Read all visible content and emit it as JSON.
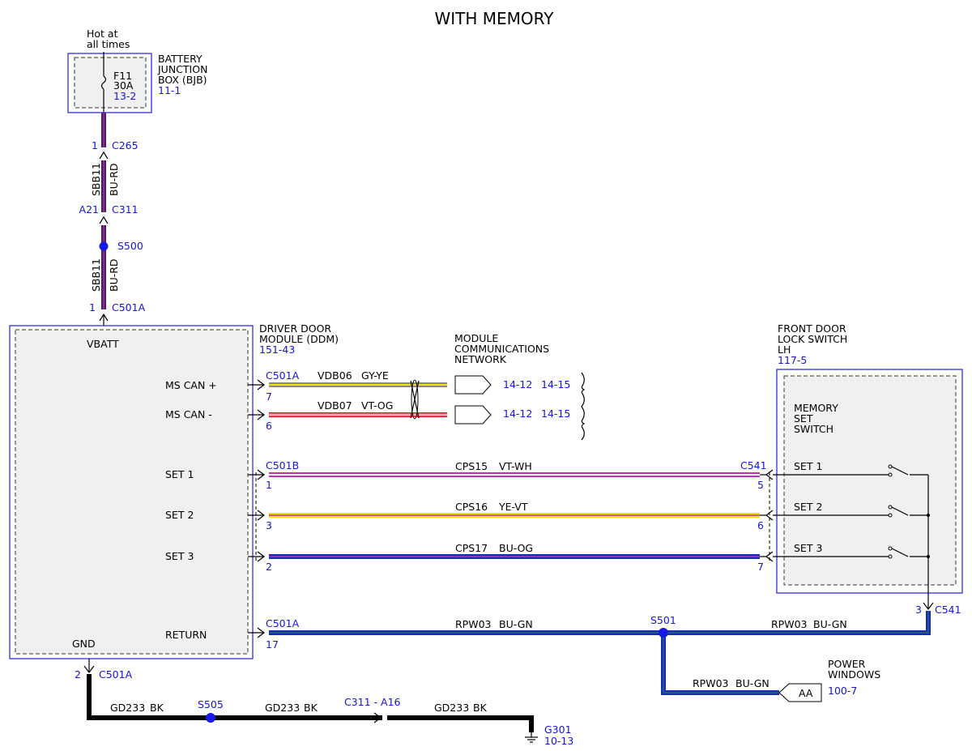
{
  "title": "WITH MEMORY",
  "colors": {
    "blue_label": "#1515d8",
    "box_outline": "#3030e0",
    "box_fill": "#f0f0f0",
    "BU": "#1a2ab8",
    "RD": "#e01818",
    "GY": "#888888",
    "YE": "#f2e000",
    "VT": "#c030c0",
    "OG": "#ff9030",
    "WH": "#ffffff",
    "GN": "#22aa22",
    "BK": "#000000",
    "pink": "#f4a0b8",
    "splice": "#1818e8"
  },
  "fuse_source": {
    "label_line1": "Hot at",
    "label_line2": "all times"
  },
  "bjb": {
    "name_line1": "BATTERY",
    "name_line2": "JUNCTION",
    "name_line3": "BOX (BJB)",
    "ref": "11-1",
    "fuse_name": "F11",
    "fuse_rating": "30A",
    "fuse_ref": "13-2"
  },
  "vertical_feed": {
    "c265_pin": "1",
    "c265": "C265",
    "circuit": "SBB11",
    "color": "BU-RD",
    "c311_pin": "A21",
    "c311": "C311",
    "splice": "S500",
    "c501a_pin": "1",
    "c501a": "C501A"
  },
  "ddm": {
    "name_line1": "DRIVER DOOR",
    "name_line2": "MODULE (DDM)",
    "ref": "151-43",
    "vbatt": "VBATT",
    "gnd": "GND",
    "pins": {
      "ms_can_plus": "MS CAN +",
      "ms_can_minus": "MS CAN -",
      "set1": "SET 1",
      "set2": "SET 2",
      "set3": "SET 3",
      "return": "RETURN"
    }
  },
  "network": {
    "title_line1": "MODULE",
    "title_line2": "COMMUNICATIONS",
    "title_line3": "NETWORK",
    "can_plus": {
      "connector": "C501A",
      "pin": "7",
      "circuit": "VDB06",
      "color": "GY-YE",
      "ref1": "14-12",
      "ref2": "14-15"
    },
    "can_minus": {
      "pin": "6",
      "circuit": "VDB07",
      "color": "VT-OG",
      "ref1": "14-12",
      "ref2": "14-15"
    }
  },
  "set_wires": [
    {
      "ddm_connector": "C501B",
      "ddm_pin": "1",
      "circuit": "CPS15",
      "color": "VT-WH",
      "switch_connector": "C541",
      "switch_pin": "5",
      "switch_label": "SET 1"
    },
    {
      "ddm_pin": "3",
      "circuit": "CPS16",
      "color": "YE-VT",
      "switch_pin": "6",
      "switch_label": "SET 2"
    },
    {
      "ddm_pin": "2",
      "circuit": "CPS17",
      "color": "BU-OG",
      "switch_pin": "7",
      "switch_label": "SET 3"
    }
  ],
  "front_switch": {
    "name_line1": "FRONT DOOR",
    "name_line2": "LOCK SWITCH",
    "name_line3": "LH",
    "ref": "117-5",
    "inner_line1": "MEMORY",
    "inner_line2": "SET",
    "inner_line3": "SWITCH",
    "out_pin": "3",
    "out_connector": "C541"
  },
  "return_wire": {
    "connector": "C501A",
    "pin": "17",
    "circuit_left": "RPW03",
    "color_left": "BU-GN",
    "splice": "S501",
    "circuit_right": "RPW03",
    "color_right": "BU-GN",
    "branch_circuit": "RPW03",
    "branch_color": "BU-GN",
    "branch_target": "AA",
    "branch_name_line1": "POWER",
    "branch_name_line2": "WINDOWS",
    "branch_ref": "100-7"
  },
  "ground": {
    "pin": "2",
    "connector": "C501A",
    "circuit1": "GD233",
    "color1": "BK",
    "splice": "S505",
    "circuit2": "GD233",
    "color2": "BK",
    "inline_connector": "C311 - A16",
    "circuit3": "GD233",
    "color3": "BK",
    "ground_point": "G301",
    "ground_ref": "10-13"
  }
}
